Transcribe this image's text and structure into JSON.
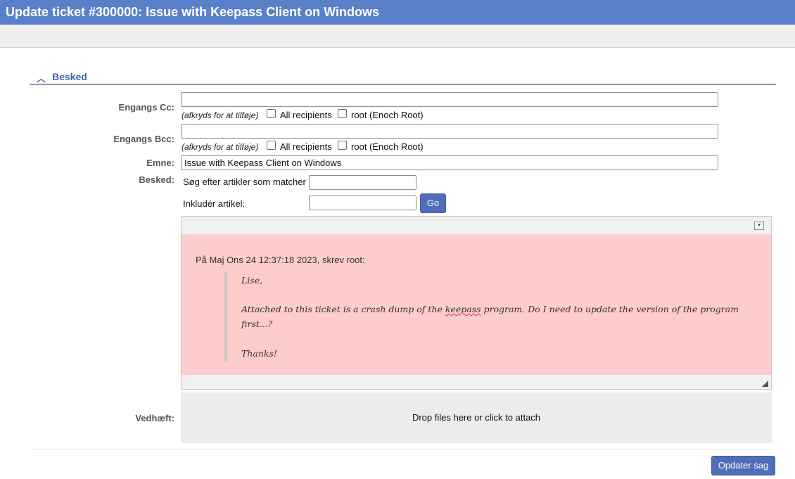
{
  "window": {
    "title": "Update ticket #300000: Issue with Keepass Client on Windows"
  },
  "section": {
    "title": "Besked"
  },
  "cc": {
    "label": "Engangs Cc:",
    "value": "",
    "hint": "(afkryds for at tilføje)",
    "opt_all": "All recipients",
    "opt_root": "root (Enoch Root)"
  },
  "bcc": {
    "label": "Engangs Bcc:",
    "value": "",
    "hint": "(afkryds for at tilføje)",
    "opt_all": "All recipients",
    "opt_root": "root (Enoch Root)"
  },
  "subject": {
    "label": "Emne:",
    "value": "Issue with Keepass Client on Windows"
  },
  "message": {
    "label": "Besked:",
    "search_label": "Søg efter artikler som matcher",
    "search_value": "",
    "include_label": "Inkludér artikel:",
    "include_value": "",
    "go_label": "Go"
  },
  "editor": {
    "dropdown_icon": "▾",
    "intro": "På Maj Ons 24 12:37:18 2023, skrev root:",
    "greeting": "Lise,",
    "body_pre": "Attached to this ticket is a crash dump of the ",
    "body_word": "keepass",
    "body_post": " program. Do I need to update the version of the program",
    "body_line2": "first...?",
    "closing": "Thanks!"
  },
  "attach": {
    "label": "Vedhæft:",
    "drop_text": "Drop files here or click to attach"
  },
  "submit": {
    "label": "Opdater sag"
  },
  "colors": {
    "header_bg": "#5a80c9",
    "button_bg": "#4e6fb8",
    "quote_bg": "#fecccc"
  }
}
